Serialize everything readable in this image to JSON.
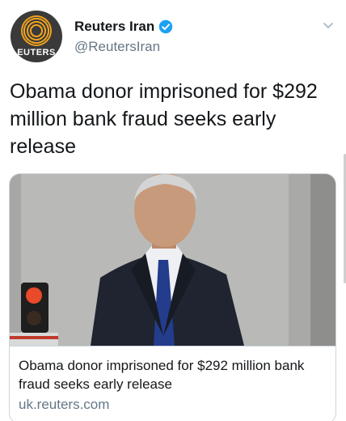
{
  "account": {
    "display_name": "Reuters Iran",
    "handle": "@ReutersIran",
    "avatar_text": "EUTERS",
    "verified": true
  },
  "tweet": {
    "text": "Obama donor imprisoned for $292 million bank fraud seeks early release"
  },
  "card": {
    "title": "Obama donor imprisoned for $292 million bank fraud seeks early release",
    "domain": "uk.reuters.com"
  },
  "colors": {
    "verified_blue": "#1da1f2",
    "secondary_text": "#657786",
    "brand_orange": "#f2a21d"
  },
  "icons": {
    "verified": "verified-badge-icon",
    "menu": "chevron-down-icon"
  }
}
